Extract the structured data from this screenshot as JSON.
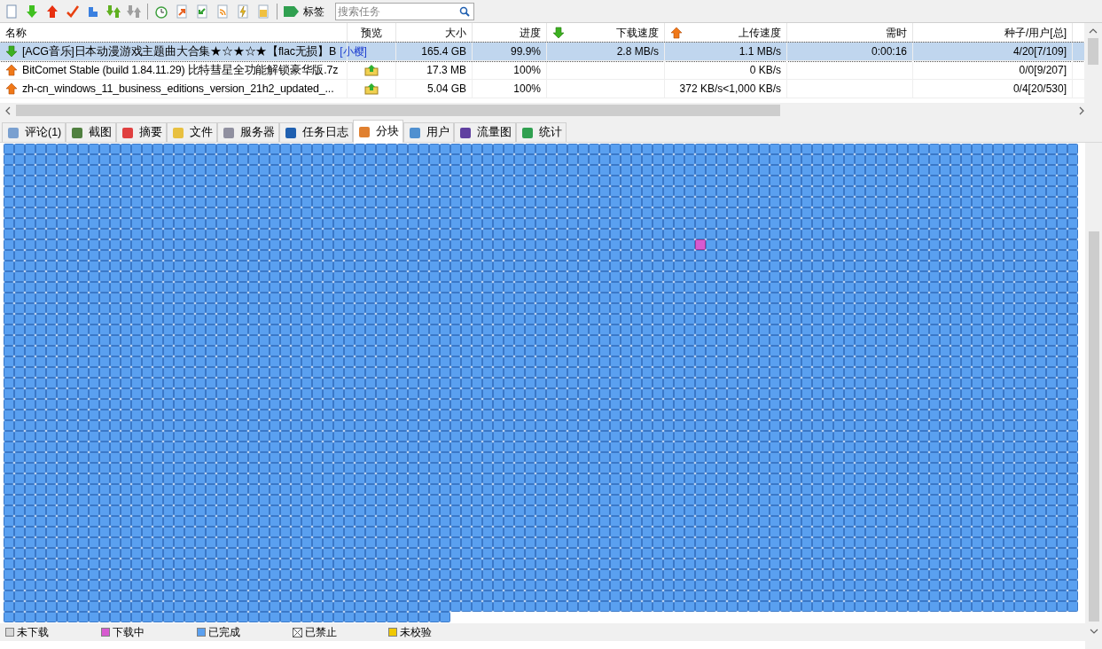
{
  "toolbar": {
    "tag_button": "标签",
    "search": {
      "placeholder": "搜索任务"
    }
  },
  "table": {
    "columns": [
      {
        "label": "名称",
        "kind": "name"
      },
      {
        "label": "预览",
        "kind": "preview"
      },
      {
        "label": "大小",
        "kind": "size"
      },
      {
        "label": "进度",
        "kind": "progress"
      },
      {
        "label": "下载速度",
        "kind": "down"
      },
      {
        "label": "上传速度",
        "kind": "up"
      },
      {
        "label": "需时",
        "kind": "time"
      },
      {
        "label": "种子/用户[总]",
        "kind": "seeds"
      }
    ],
    "rows": [
      {
        "kind": "downloading",
        "selected": true,
        "name": "[ACG音乐]日本动漫游戏主题曲大合集★☆★☆★【flac无损】B",
        "tag": "[小樱]",
        "preview": false,
        "size": "165.4 GB",
        "progress": "99.9%",
        "down": "2.8 MB/s",
        "up": "1.1 MB/s",
        "time": "0:00:16",
        "seeds": "4/20[7/109]"
      },
      {
        "kind": "seeding",
        "selected": false,
        "name": "BitComet Stable (build 1.84.11.29) 比特彗星全功能解锁豪华版.7z",
        "preview": true,
        "size": "17.3 MB",
        "progress": "100%",
        "up": "0 KB/s",
        "seeds": "0/0[9/207]"
      },
      {
        "kind": "seeding",
        "selected": false,
        "name": "zh-cn_windows_11_business_editions_version_21h2_updated_...",
        "preview": true,
        "size": "5.04 GB",
        "progress": "100%",
        "up": "372 KB/s<1,000 KB/s",
        "seeds": "0/4[20/530]"
      }
    ]
  },
  "tabs": [
    {
      "label": "评论(1)",
      "selected": false
    },
    {
      "label": "截图",
      "selected": false
    },
    {
      "label": "摘要",
      "selected": false
    },
    {
      "label": "文件",
      "selected": false
    },
    {
      "label": "服务器",
      "selected": false
    },
    {
      "label": "任务日志",
      "selected": false
    },
    {
      "label": "分块",
      "selected": true
    },
    {
      "label": "用户",
      "selected": false
    },
    {
      "label": "流量图",
      "selected": false
    },
    {
      "label": "统计",
      "selected": false
    }
  ],
  "legend": [
    {
      "label": "未下载",
      "kind": "swatch",
      "color": "#d8d8d8"
    },
    {
      "label": "下载中",
      "kind": "swatch",
      "color": "#d85ad0"
    },
    {
      "label": "已完成",
      "kind": "swatch",
      "color": "#5aa0f0"
    },
    {
      "label": "已禁止",
      "kind": "cross",
      "color": "#ffffff"
    },
    {
      "label": "未校验",
      "kind": "swatch",
      "color": "#f0c800"
    }
  ]
}
